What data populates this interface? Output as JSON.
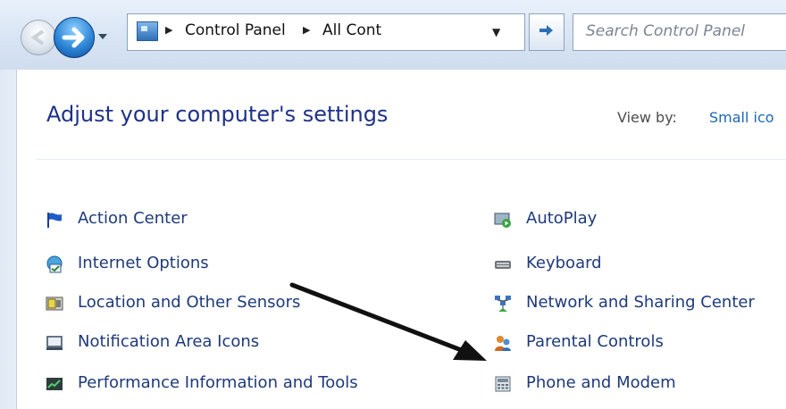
{
  "nav": {
    "breadcrumb": [
      "Control Panel",
      "All Cont"
    ],
    "search_placeholder": "Search Control Panel"
  },
  "header": {
    "title": "Adjust your computer's settings",
    "view_by_label": "View by:",
    "view_by_value": "Small ico"
  },
  "items_left": [
    {
      "label": "Action Center",
      "icon": "flag-icon"
    },
    {
      "label": "Internet Options",
      "icon": "internet-options-icon"
    },
    {
      "label": "Location and Other Sensors",
      "icon": "sensors-icon"
    },
    {
      "label": "Notification Area Icons",
      "icon": "notification-icon"
    },
    {
      "label": "Performance Information and Tools",
      "icon": "performance-icon"
    }
  ],
  "items_right": [
    {
      "label": "AutoPlay",
      "icon": "autoplay-icon"
    },
    {
      "label": "Keyboard",
      "icon": "keyboard-icon"
    },
    {
      "label": "Network and Sharing Center",
      "icon": "network-icon"
    },
    {
      "label": "Parental Controls",
      "icon": "parental-controls-icon"
    },
    {
      "label": "Phone and Modem",
      "icon": "phone-modem-icon"
    }
  ],
  "colors": {
    "title": "#1e3287",
    "link": "#1e3a7a",
    "view_by_value": "#1e67b5"
  }
}
